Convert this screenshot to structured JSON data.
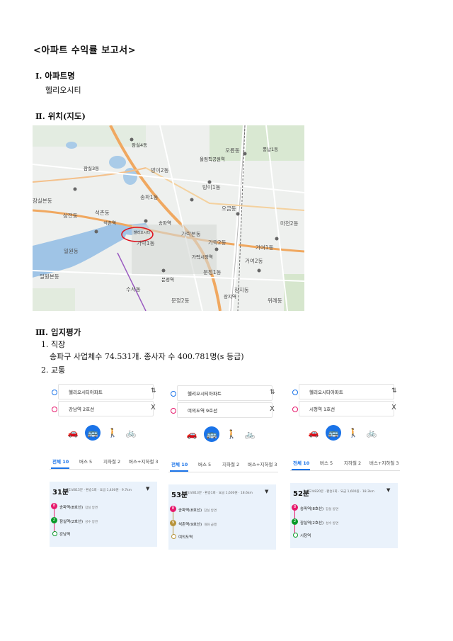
{
  "doc_title": "<아파트 수익률 보고서>",
  "section1": {
    "heading": "Ⅰ. 아파트명",
    "value": "헬리오시티"
  },
  "section2": {
    "heading": "Ⅱ. 위치(지도)"
  },
  "map": {
    "labels": [
      "잠실본동",
      "삼전동",
      "석촌동",
      "송파1동",
      "방이1동",
      "방이2동",
      "오륜동",
      "가락본동",
      "가락1동",
      "가락2동",
      "문정1동",
      "문정2동",
      "장지동",
      "위례동",
      "마천2동",
      "거여1동",
      "거여2동",
      "오금동",
      "풍납1동",
      "잠실3동",
      "잠실4동",
      "일원동",
      "수서동",
      "헬리오시티",
      "송파역",
      "가락시장역",
      "문정역",
      "석촌역",
      "올림픽공원역",
      "장지역",
      "일원본동"
    ],
    "marker_label": "헬리오시티"
  },
  "section3": {
    "heading": "Ⅲ. 입지평가",
    "item1_heading": "1. 직장",
    "item1_text": "송파구 사업체수 74.531개. 종사자 수 400.781명(s 등급)",
    "item2_heading": "2. 교통"
  },
  "transit": [
    {
      "from": "헬리오시티아파트",
      "to": "강남역 2호선",
      "tabs": [
        "전체 10",
        "버스 5",
        "지하철 2",
        "버스+지하철 3"
      ],
      "time": "31분",
      "meta": "도보815분 · 환승1회 · 요금 1,400원 · 9.7km",
      "stops": [
        {
          "badge": "8",
          "name": "송파역(8호선)",
          "note": "잠실 방면",
          "color": "#e6186c"
        },
        {
          "badge": "2",
          "name": "잠실역(2호선)",
          "note": "성수 방면",
          "color": "#0a9a2a"
        },
        {
          "badge": "",
          "name": "강남역",
          "note": "",
          "color": "#0a9a2a"
        }
      ]
    },
    {
      "from": "헬리오시티아파트",
      "to": "여의도역 9호선",
      "tabs": [
        "전체 10",
        "버스 5",
        "지하철 2",
        "버스+지하철 3"
      ],
      "time": "53분",
      "meta": "도보813분 · 환승1회 · 요금 1,600원 · 18.6km",
      "stops": [
        {
          "badge": "8",
          "name": "송파역(8호선)",
          "note": "잠실 방면",
          "color": "#e6186c"
        },
        {
          "badge": "9",
          "name": "석촌역(9호선)",
          "note": "개화 급행",
          "color": "#b7933b"
        },
        {
          "badge": "",
          "name": "여의도역",
          "note": "",
          "color": "#b7933b"
        }
      ]
    },
    {
      "from": "헬리오시티아파트",
      "to": "시청역 1호선",
      "tabs": [
        "전체 10",
        "버스 5",
        "지하철 2",
        "버스+지하철 3"
      ],
      "time": "52분",
      "meta": "도보820분 · 환승1회 · 요금 1,600원 · 18.3km",
      "stops": [
        {
          "badge": "8",
          "name": "송파역(8호선)",
          "note": "잠실 방면",
          "color": "#e6186c"
        },
        {
          "badge": "2",
          "name": "잠실역(2호선)",
          "note": "성수 방면",
          "color": "#0a9a2a"
        },
        {
          "badge": "",
          "name": "시청역",
          "note": "",
          "color": "#0a9a2a"
        }
      ]
    }
  ],
  "icons": {
    "swap": "⇅",
    "close": "X",
    "car": "car-icon",
    "bus": "bus-icon",
    "walk": "walk-icon",
    "bike": "bike-icon",
    "caret": "▼"
  }
}
